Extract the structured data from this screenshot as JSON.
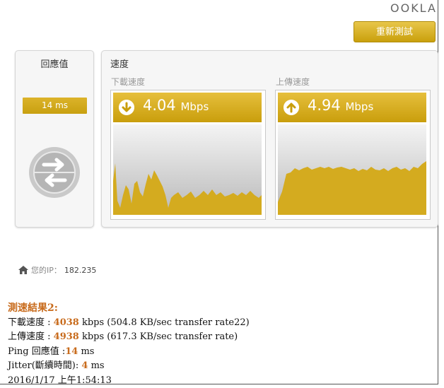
{
  "brand": "OOKLA",
  "retest_label": "重新測試",
  "ping": {
    "title": "回應值",
    "value": "14 ms"
  },
  "speed": {
    "title": "速度",
    "download": {
      "label": "下載速度",
      "value": "4.04",
      "unit": "Mbps",
      "icon": "arrow-down-icon"
    },
    "upload": {
      "label": "上傳速度",
      "value": "4.94",
      "unit": "Mbps",
      "icon": "arrow-up-icon"
    }
  },
  "ip": {
    "label": "您的IP：",
    "value": "182.235"
  },
  "results": {
    "title": "測速結果2:",
    "download_label": "下載速度 : ",
    "download_value": "4038",
    "download_rest": " kbps (504.8 KB/sec transfer rate22)",
    "upload_label": "上傳速度 : ",
    "upload_value": "4938",
    "upload_rest": " kbps (617.3 KB/sec transfer rate)",
    "ping_label": "Ping 回應值 :",
    "ping_value": "14",
    "ping_rest": " ms",
    "jitter_label": "Jitter(斷續時間): ",
    "jitter_value": "4",
    "jitter_rest": " ms",
    "timestamp": "2016/1/17 上午1:54:13"
  },
  "colors": {
    "gold": "#d4ab1f",
    "accent_text": "#c86b1c"
  }
}
